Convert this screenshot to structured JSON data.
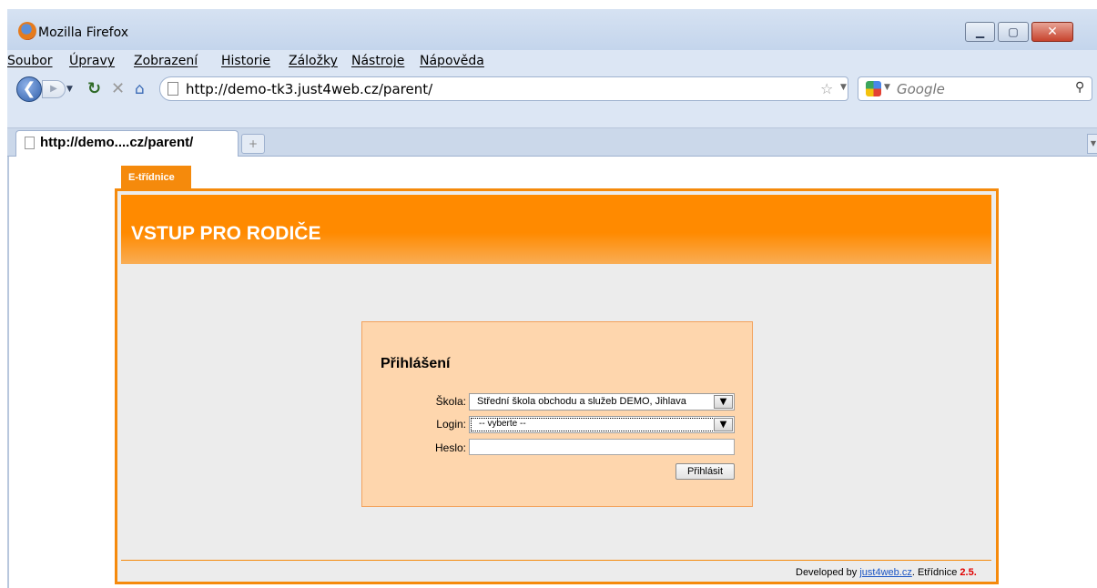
{
  "window": {
    "title": "Mozilla Firefox"
  },
  "menu": {
    "items": [
      "Soubor",
      "Úpravy",
      "Zobrazení",
      "Historie",
      "Záložky",
      "Nástroje",
      "Nápověda"
    ]
  },
  "nav": {
    "url": "http://demo-tk3.just4web.cz/parent/",
    "search_placeholder": "Google"
  },
  "tabs": [
    {
      "title": "http://demo....cz/parent/"
    }
  ],
  "page": {
    "top_tab": "E-třídnice",
    "banner_title": "VSTUP PRO RODIČE",
    "login": {
      "heading": "Přihlášení",
      "school_label": "Škola:",
      "school_value": "Střední škola obchodu a služeb DEMO, Jihlava",
      "login_label": "Login:",
      "login_value": "-- vyberte --",
      "password_label": "Heslo:",
      "submit_label": "Přihlásit"
    },
    "footer": {
      "prefix": "Developed by",
      "link": "just4web.cz",
      "suffix": ". Etřídnice",
      "version": "2.5."
    }
  },
  "colors": {
    "accent_orange": "#f58a0c",
    "login_box": "#fed6ad",
    "version_red": "#e00000"
  }
}
